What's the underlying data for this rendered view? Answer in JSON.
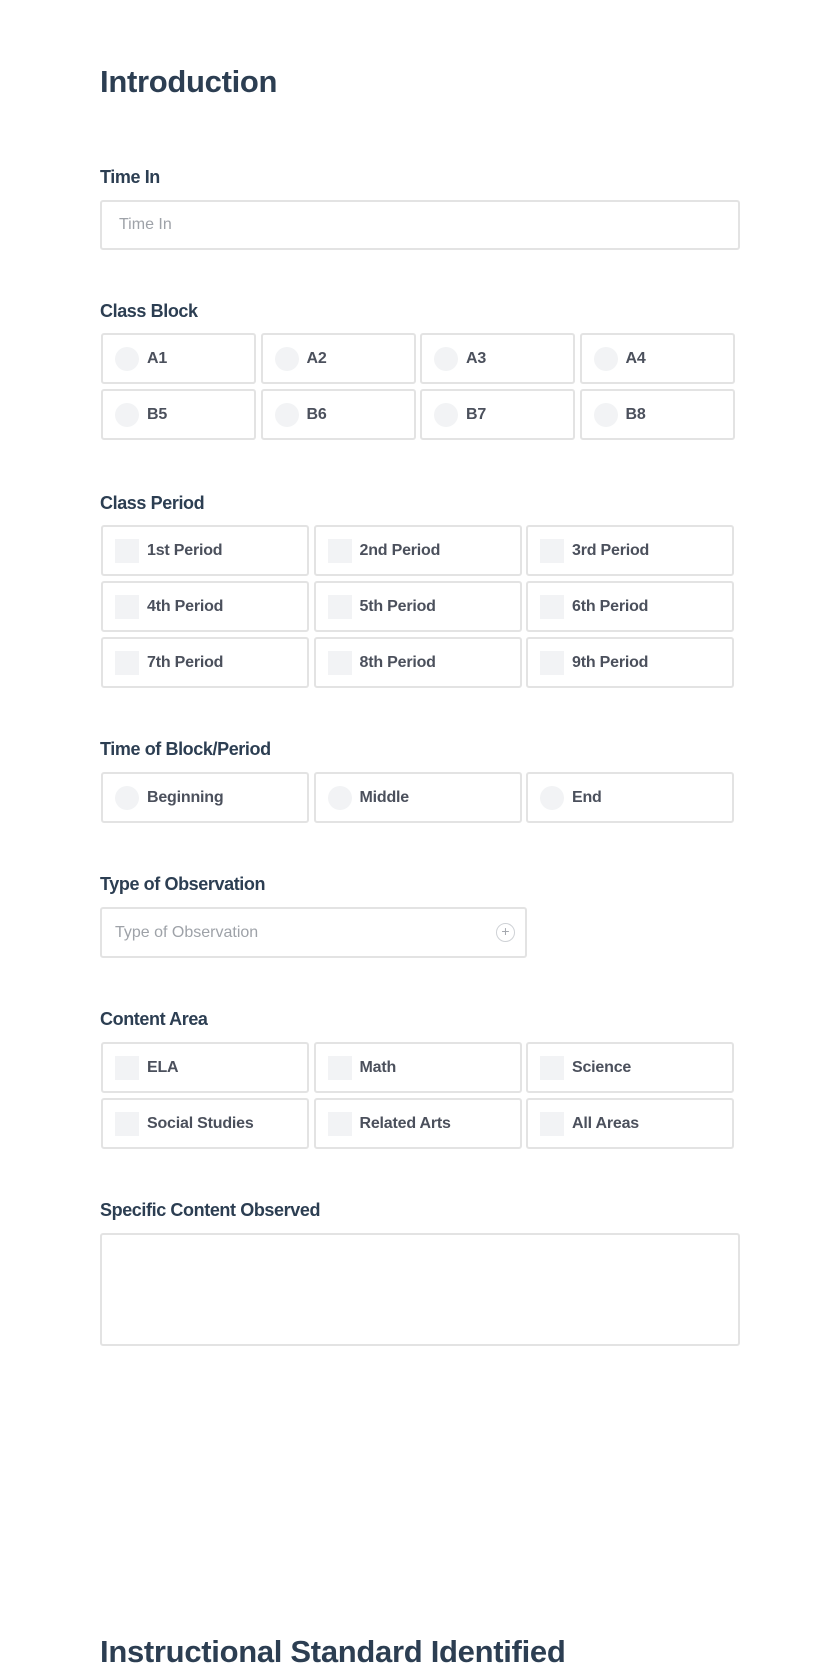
{
  "sections": {
    "introduction": {
      "title": "Introduction"
    },
    "instructional_standard": {
      "title": "Instructional Standard Identified"
    }
  },
  "time_in": {
    "label": "Time In",
    "placeholder": "Time In",
    "value": ""
  },
  "class_block": {
    "label": "Class Block",
    "type": "radio",
    "options": [
      "A1",
      "A2",
      "A3",
      "A4",
      "B5",
      "B6",
      "B7",
      "B8"
    ]
  },
  "class_period": {
    "label": "Class Period",
    "type": "checkbox",
    "options": [
      "1st Period",
      "2nd Period",
      "3rd Period",
      "4th Period",
      "5th Period",
      "6th Period",
      "7th Period",
      "8th Period",
      "9th Period"
    ]
  },
  "time_of_block": {
    "label": "Time of Block/Period",
    "type": "radio",
    "options": [
      "Beginning",
      "Middle",
      "End"
    ]
  },
  "type_of_observation": {
    "label": "Type of Observation",
    "placeholder": "Type of Observation",
    "icon": "plus-circle-icon",
    "icon_glyph": "+"
  },
  "content_area": {
    "label": "Content Area",
    "type": "checkbox",
    "options": [
      "ELA",
      "Math",
      "Science",
      "Social Studies",
      "Related Arts",
      "All Areas"
    ]
  },
  "specific_content": {
    "label": "Specific Content Observed",
    "value": ""
  },
  "colors": {
    "heading": "#2c3e52",
    "option_text": "#4b505c",
    "placeholder": "#9ea2a8",
    "border": "#e3e3e3",
    "control_fill": "#f2f3f5"
  }
}
